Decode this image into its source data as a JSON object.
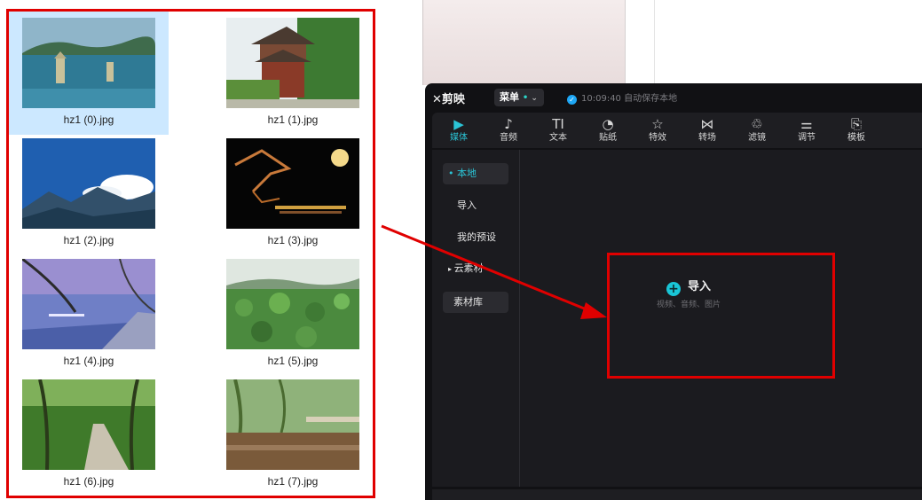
{
  "files": [
    {
      "name": "hz1 (0).jpg",
      "selected": true
    },
    {
      "name": "hz1 (1).jpg",
      "selected": false
    },
    {
      "name": "hz1 (2).jpg",
      "selected": false
    },
    {
      "name": "hz1 (3).jpg",
      "selected": false
    },
    {
      "name": "hz1 (4).jpg",
      "selected": false
    },
    {
      "name": "hz1 (5).jpg",
      "selected": false
    },
    {
      "name": "hz1 (6).jpg",
      "selected": false
    },
    {
      "name": "hz1 (7).jpg",
      "selected": false
    }
  ],
  "editor": {
    "app_name": "剪映",
    "menu_label": "菜单",
    "save_status": "10:09:40 自动保存本地",
    "toolbar": [
      {
        "label": "媒体",
        "icon": "media-icon",
        "active": true
      },
      {
        "label": "音频",
        "icon": "audio-icon",
        "active": false
      },
      {
        "label": "文本",
        "icon": "text-icon",
        "active": false
      },
      {
        "label": "贴纸",
        "icon": "sticker-icon",
        "active": false
      },
      {
        "label": "特效",
        "icon": "effects-icon",
        "active": false
      },
      {
        "label": "转场",
        "icon": "transition-icon",
        "active": false
      },
      {
        "label": "滤镜",
        "icon": "filter-icon",
        "active": false
      },
      {
        "label": "调节",
        "icon": "adjust-icon",
        "active": false
      },
      {
        "label": "模板",
        "icon": "template-icon",
        "active": false
      }
    ],
    "sidebar": {
      "local": "本地",
      "import": "导入",
      "presets": "我的预设",
      "cloud": "云素材",
      "library": "素材库"
    },
    "import": {
      "label": "导入",
      "hint": "视频、音频、图片"
    }
  },
  "colors": {
    "accent": "#19c5d6",
    "highlight_red": "#e00000"
  }
}
